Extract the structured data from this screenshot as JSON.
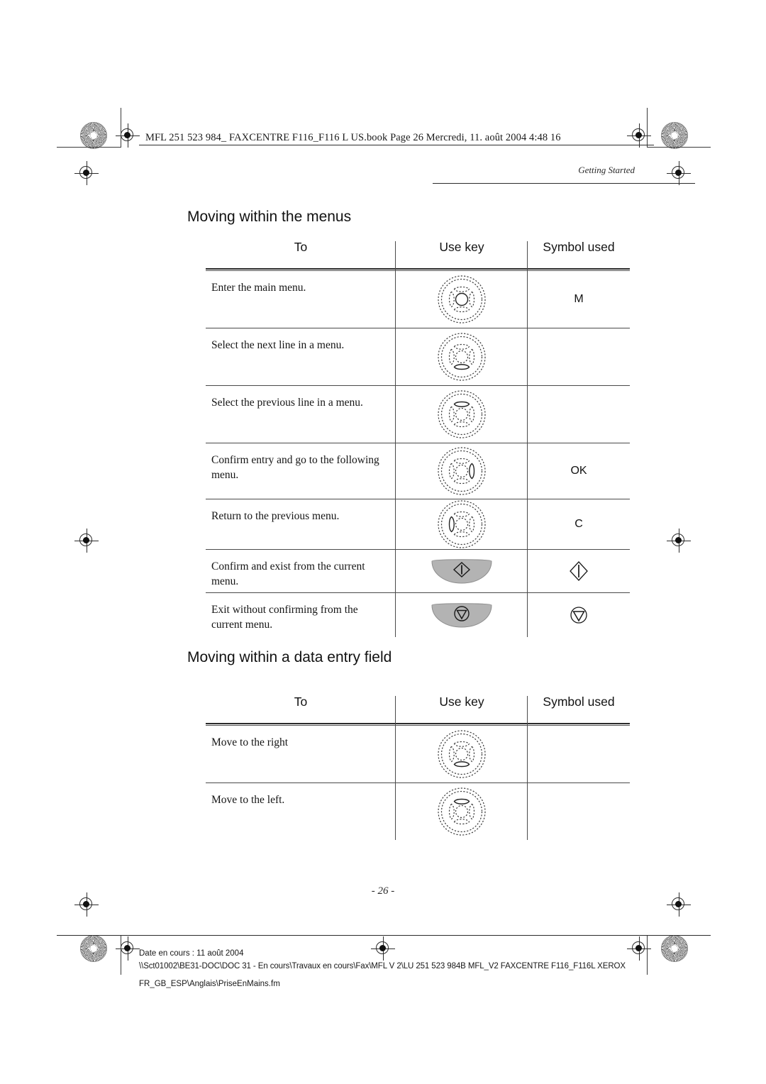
{
  "header": {
    "book_line": "MFL 251 523 984_ FAXCENTRE F116_F116 L US.book  Page 26  Mercredi, 11. août 2004  4:48 16",
    "running_head": "Getting Started"
  },
  "page_number": "- 26 -",
  "columns": {
    "to": "To",
    "use_key": "Use key",
    "symbol_used": "Symbol used"
  },
  "sections": [
    {
      "title": "Moving within the menus",
      "rows": [
        {
          "to": "Enter the main menu.",
          "key_icon": "navpad-center-key",
          "symbol": "M",
          "symbol_icon": ""
        },
        {
          "to": "Select the next line in a menu.",
          "key_icon": "navpad-down-key",
          "symbol": "",
          "symbol_icon": ""
        },
        {
          "to": "Select the previous line in a menu.",
          "key_icon": "navpad-up-key",
          "symbol": "",
          "symbol_icon": ""
        },
        {
          "to": "Confirm entry and go to the following menu.",
          "key_icon": "navpad-right-key",
          "symbol": "OK",
          "symbol_icon": ""
        },
        {
          "to": "Return to the previous menu.",
          "key_icon": "navpad-left-key",
          "symbol": "C",
          "symbol_icon": ""
        },
        {
          "to": "Confirm and exist from the current menu.",
          "key_icon": "start-button",
          "symbol": "",
          "symbol_icon": "diamond-start-icon"
        },
        {
          "to": "Exit without confirming from the current menu.",
          "key_icon": "stop-button",
          "symbol": "",
          "symbol_icon": "circle-stop-icon"
        }
      ]
    },
    {
      "title": "Moving within a data entry field",
      "rows": [
        {
          "to": "Move to the right",
          "key_icon": "navpad-down-key",
          "symbol": "",
          "symbol_icon": ""
        },
        {
          "to": "Move to the left.",
          "key_icon": "navpad-up-key",
          "symbol": "",
          "symbol_icon": ""
        }
      ]
    }
  ],
  "footer": {
    "line1": "Date en cours : 11 août 2004",
    "line2": "\\\\Sct01002\\BE31-DOC\\DOC 31 - En cours\\Travaux en cours\\Fax\\MFL V 2\\LU 251 523 984B MFL_V2 FAXCENTRE F116_F116L XEROX",
    "line3": "FR_GB_ESP\\Anglais\\PriseEnMains.fm"
  },
  "colors": {
    "button_fill": "#b3b3b3",
    "rule": "#2b2b2b",
    "text": "#151515"
  }
}
